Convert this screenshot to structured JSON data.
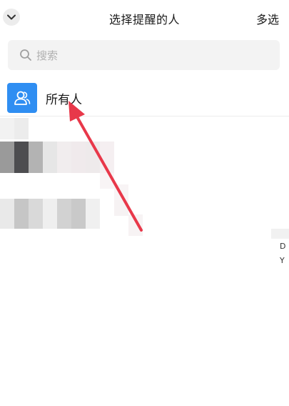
{
  "header": {
    "title": "选择提醒的人",
    "multi_select_label": "多选",
    "collapse_icon": "chevron-down-icon"
  },
  "search": {
    "placeholder": "搜索",
    "icon": "search-icon"
  },
  "everyone": {
    "label": "所有人",
    "icon": "group-avatar-icon",
    "avatar_color": "#2f8ef2"
  },
  "side_index": [
    "D",
    "Y"
  ],
  "annotation": {
    "arrow_color": "#e8384a"
  }
}
